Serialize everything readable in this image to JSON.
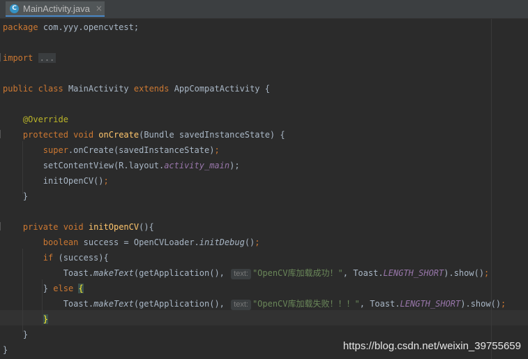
{
  "tab": {
    "icon_letter": "C",
    "label": "MainActivity.java",
    "close_symbol": "×"
  },
  "code": {
    "package_kw": "package",
    "package_name": "com.yyy.opencvtest;",
    "import_kw": "import",
    "import_folded": "...",
    "class_public": "public",
    "class_kw": "class",
    "class_name": "MainActivity",
    "extends_kw": "extends",
    "class_parent": "AppCompatActivity {",
    "override_ann": "@Override",
    "oncreate_mods": "protected void",
    "oncreate_name": "onCreate",
    "oncreate_params": "(Bundle savedInstanceState) {",
    "super_kw": "super",
    "super_call": ".onCreate(savedInstanceState)",
    "setcontent_call": "setContentView(R.layout.",
    "layout_field": "activity_main",
    "setcontent_end": ");",
    "initcall": "initOpenCV()",
    "close_brace": "}",
    "init_mods": "private void",
    "init_name": "initOpenCV",
    "init_params": "(){",
    "boolean_kw": "boolean",
    "success_decl": "success = OpenCVLoader.",
    "initdebug": "initDebug",
    "initdebug_end": "()",
    "if_kw": "if",
    "if_cond": "(success){",
    "toast_prefix": "Toast.",
    "maketext": "makeText",
    "maketext_args": "(getApplication(),",
    "param_hint": "text:",
    "success_msg": "\"OpenCV库加载成功！\"",
    "length_prefix": ", Toast.",
    "length_short": "LENGTH_SHORT",
    "show_call": ").show()",
    "semicolon": ";",
    "else_close": "}",
    "else_kw": "else",
    "else_open": "{",
    "fail_msg": "\"OpenCV库加载失败！！！\""
  },
  "watermark": "https://blog.csdn.net/weixin_39755659"
}
